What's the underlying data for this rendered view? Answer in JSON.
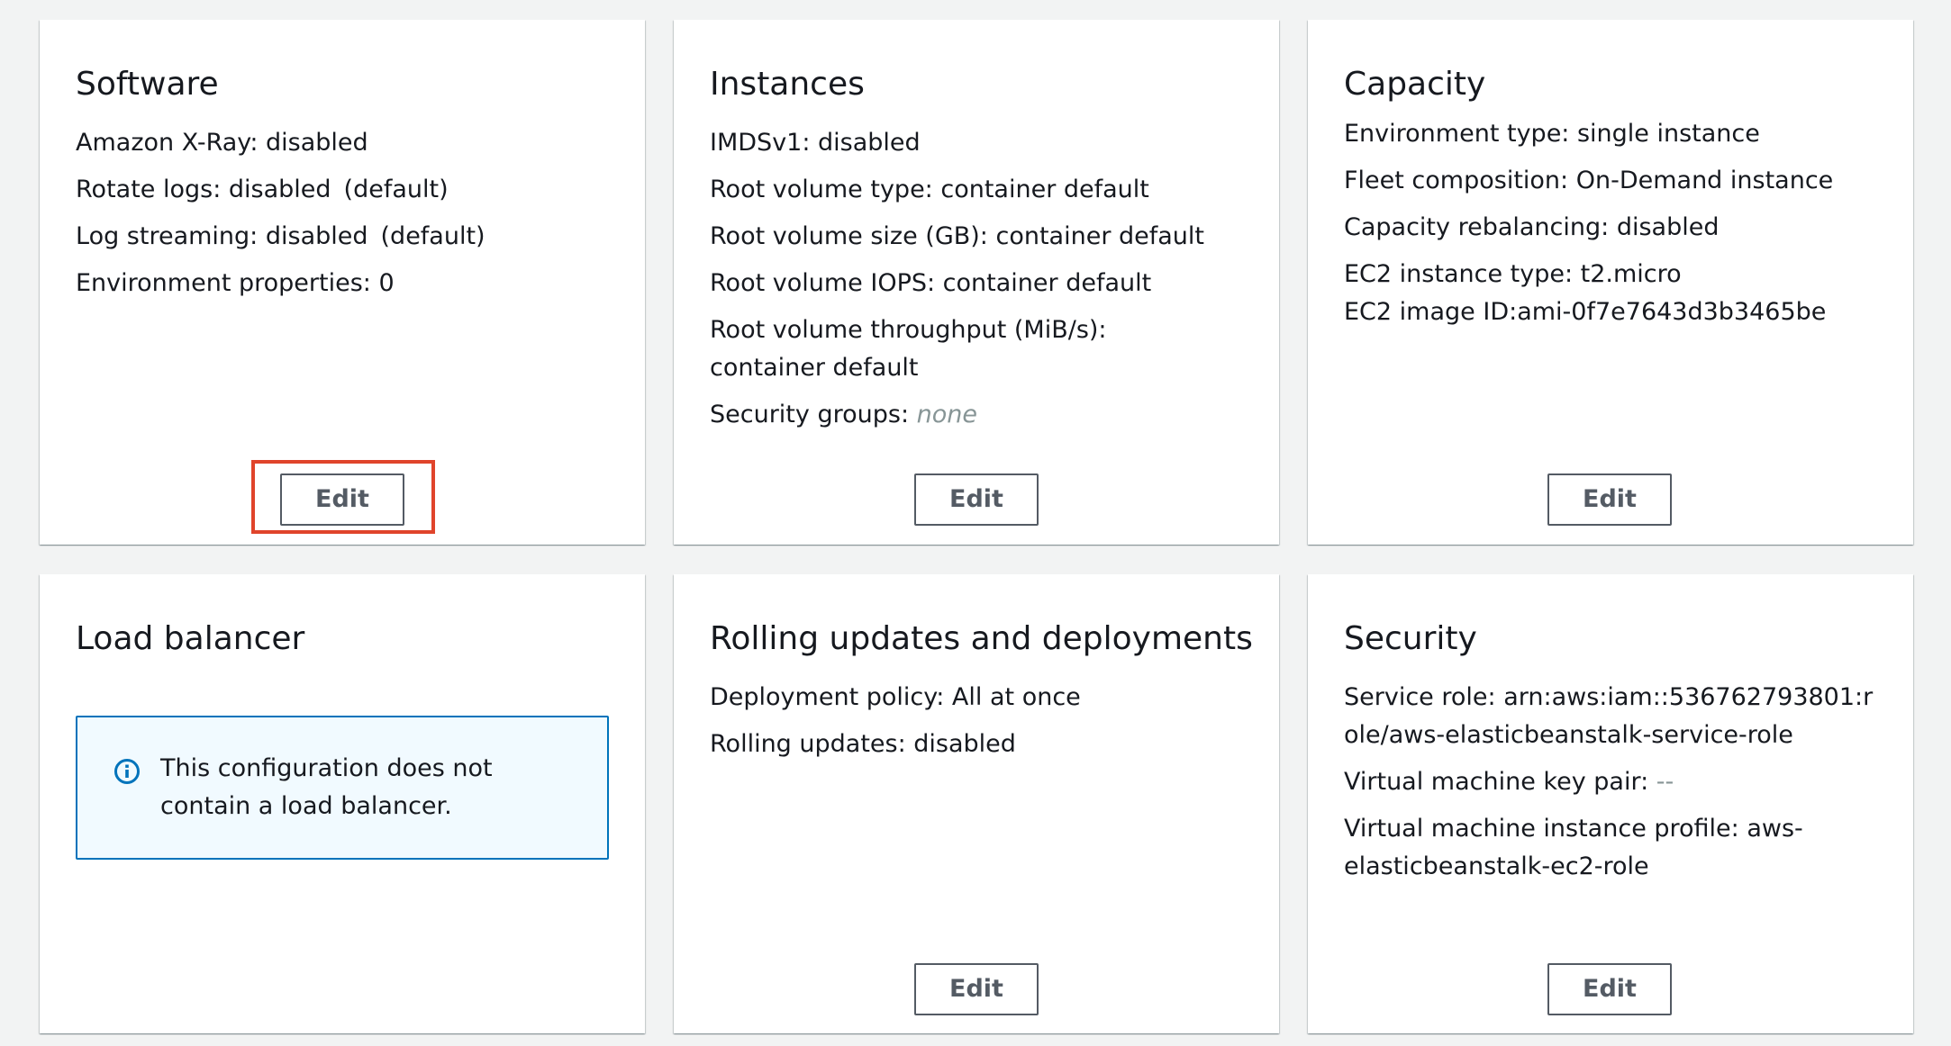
{
  "software": {
    "title": "Software",
    "xray": "Amazon X-Ray: disabled",
    "rotate_logs": "Rotate logs: disabled",
    "rotate_logs_default": "(default)",
    "log_streaming": "Log streaming: disabled",
    "log_streaming_default": "(default)",
    "env_properties": "Environment properties: 0",
    "edit_label": "Edit"
  },
  "instances": {
    "title": "Instances",
    "imdsv1": "IMDSv1: disabled",
    "root_volume_type": "Root volume type: container default",
    "root_volume_size": "Root volume size (GB): container default",
    "root_volume_iops": "Root volume IOPS: container default",
    "root_volume_throughput": "Root volume throughput (MiB/s): container default",
    "security_groups_label": "Security groups:",
    "security_groups_value": "none",
    "edit_label": "Edit"
  },
  "capacity": {
    "title": "Capacity",
    "environment_type": "Environment type: single instance",
    "fleet_composition": "Fleet composition: On-Demand instance",
    "capacity_rebalancing": "Capacity rebalancing: disabled",
    "instance_type": "EC2 instance type: t2.micro",
    "image_id": "EC2 image ID:ami-0f7e7643d3b3465be",
    "edit_label": "Edit"
  },
  "load_balancer": {
    "title": "Load balancer",
    "info_icon": "info-circle-icon",
    "info_text": "This configuration does not contain a load balancer."
  },
  "rolling_updates": {
    "title": "Rolling updates and deployments",
    "deployment_policy": "Deployment policy: All at once",
    "rolling_updates": "Rolling updates: disabled",
    "edit_label": "Edit"
  },
  "security": {
    "title": "Security",
    "service_role": "Service role: arn:aws:iam::536762793801:role/aws-elasticbeanstalk-service-role",
    "key_pair_label": "Virtual machine key pair:",
    "key_pair_value": "--",
    "instance_profile": "Virtual machine instance profile: aws-elasticbeanstalk-ec2-role",
    "edit_label": "Edit"
  },
  "colors": {
    "highlight": "#e0442b",
    "info_border": "#0073bb",
    "info_background": "#f1faff",
    "button_border": "#545b64"
  }
}
